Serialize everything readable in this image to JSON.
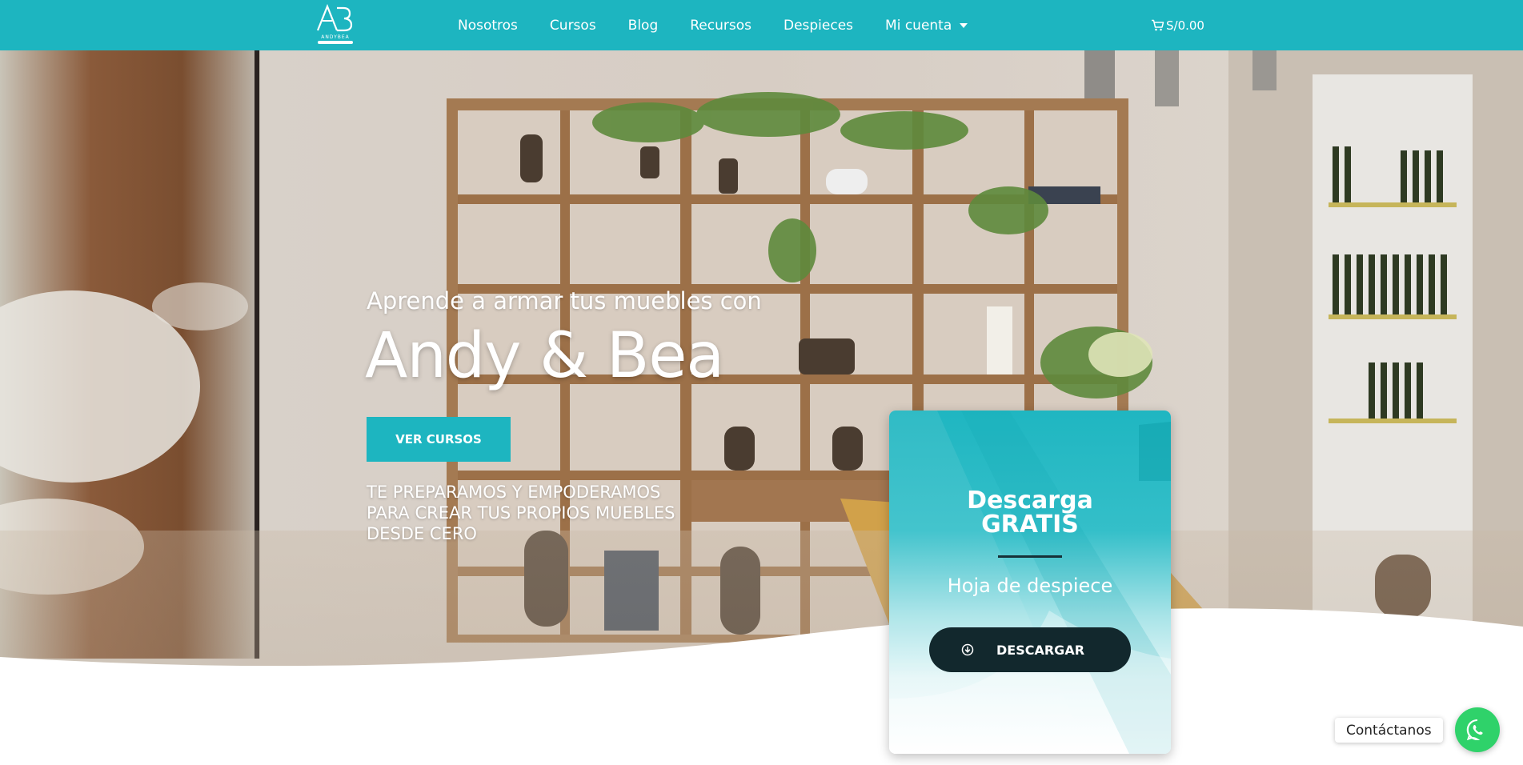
{
  "header": {
    "logo_text": "AB",
    "logo_caption": "ANDYBEA",
    "nav": [
      {
        "label": "Nosotros"
      },
      {
        "label": "Cursos"
      },
      {
        "label": "Blog"
      },
      {
        "label": "Recursos"
      },
      {
        "label": "Despieces"
      },
      {
        "label": "Mi cuenta",
        "dropdown": true
      }
    ],
    "cart_total": "S/0.00",
    "cart_icon": "cart-icon"
  },
  "hero": {
    "subtitle": "Aprende a armar tus muebles con",
    "title": "Andy & Bea",
    "cta_label": "VER CURSOS",
    "tagline": [
      "TE PREPARAMOS Y EMPODERAMOS",
      "PARA CREAR TUS PROPIOS MUEBLES",
      "DESDE CERO"
    ]
  },
  "download_card": {
    "title_line1": "Descarga",
    "title_line2": "GRATIS",
    "subtitle": "Hoja de despiece",
    "button_label": "DESCARGAR",
    "button_icon": "download-circle-icon"
  },
  "contact": {
    "label": "Contáctanos",
    "icon": "whatsapp-icon"
  },
  "colors": {
    "brand": "#1db5c0",
    "dark": "#12282d",
    "whatsapp": "#2fd26a"
  }
}
